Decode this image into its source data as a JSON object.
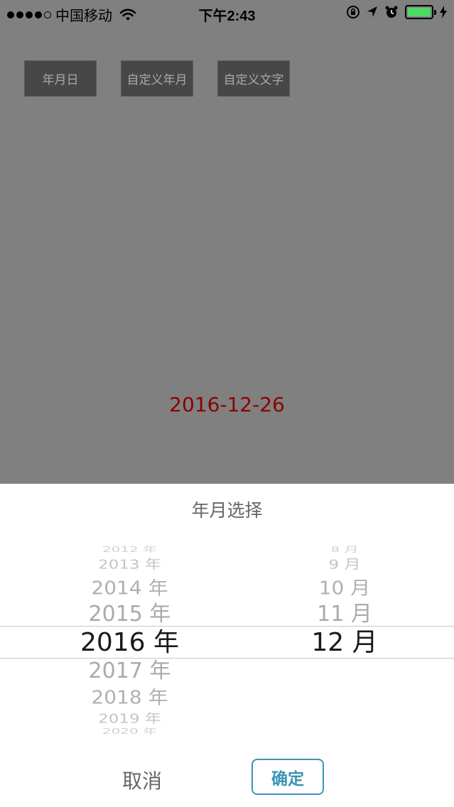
{
  "status_bar": {
    "carrier": "中国移动",
    "time": "下午2:43",
    "signal_bars_filled": 4,
    "signal_bars_total": 5,
    "battery_color": "#4cd964",
    "icons": [
      "wifi-icon",
      "orientation-lock-icon",
      "location-arrow-icon",
      "alarm-clock-icon",
      "battery-icon",
      "charging-bolt-icon"
    ]
  },
  "buttons": {
    "ymd": "年月日",
    "custom_year_month": "自定义年月",
    "custom_text": "自定义文字"
  },
  "result": {
    "date": "2016-12-26",
    "color": "#8b0000"
  },
  "picker_sheet": {
    "title": "年月选择",
    "years": [
      "2012 年",
      "2013 年",
      "2014 年",
      "2015 年",
      "2016 年",
      "2017 年",
      "2018 年",
      "2019 年",
      "2020 年"
    ],
    "selected_year": "2016 年",
    "months": [
      "8 月",
      "9 月",
      "10 月",
      "11 月",
      "12 月"
    ],
    "selected_month": "12 月",
    "cancel": "取消",
    "confirm": "确定",
    "accent_color": "#3a94b4"
  }
}
